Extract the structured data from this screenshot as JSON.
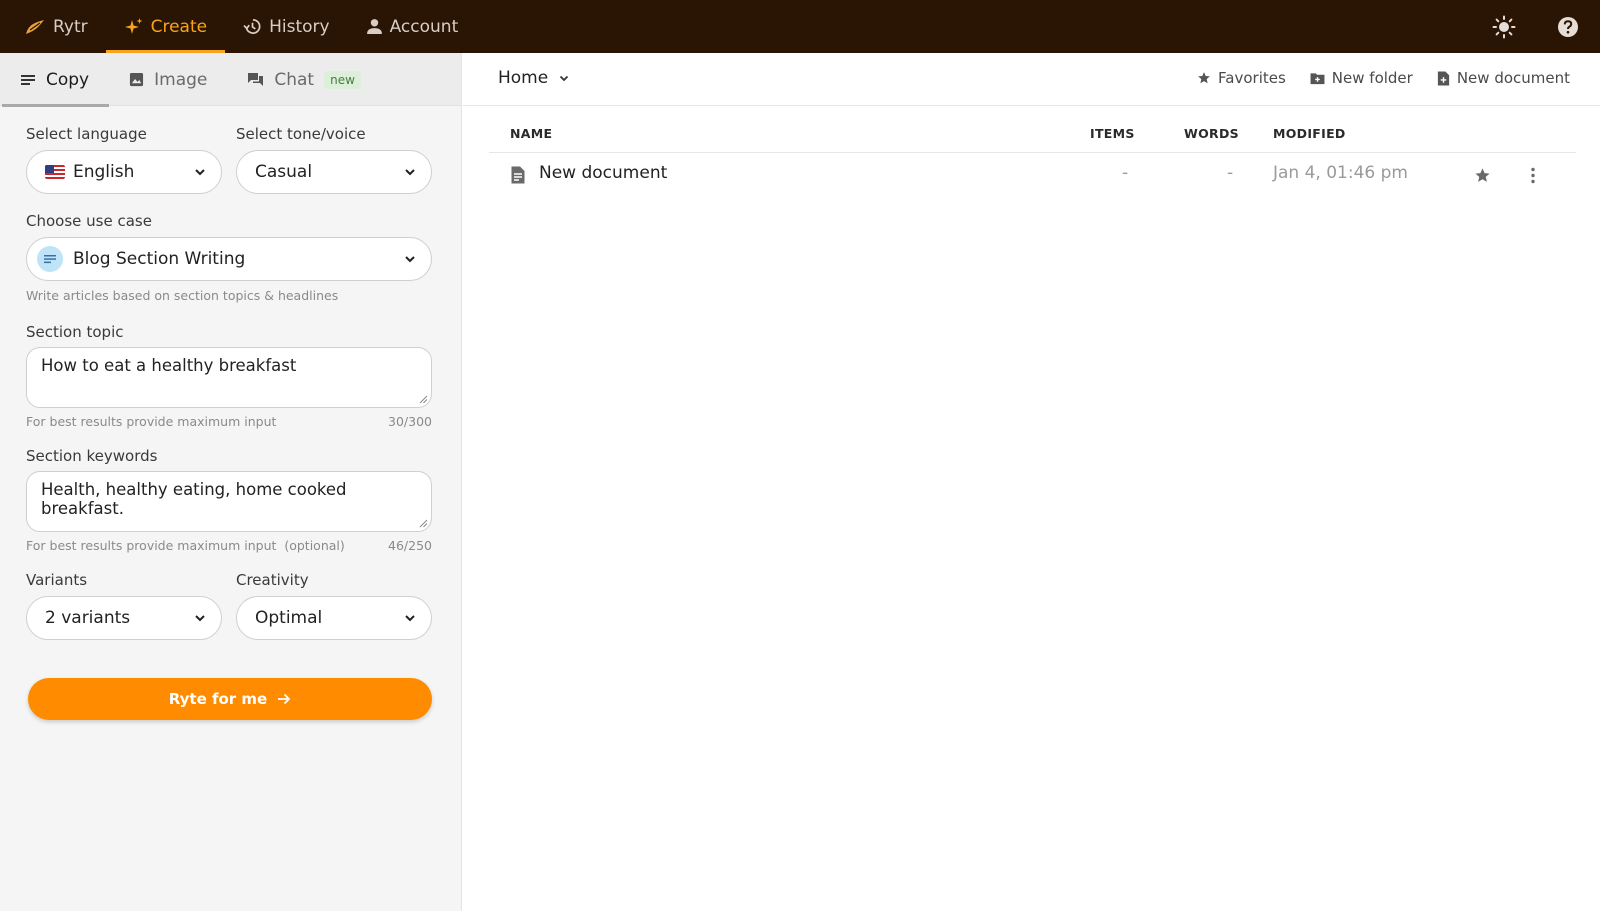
{
  "topnav": {
    "items": [
      {
        "label": "Rytr",
        "icon": "rytr-logo-icon"
      },
      {
        "label": "Create",
        "icon": "sparkle-icon"
      },
      {
        "label": "History",
        "icon": "history-icon"
      },
      {
        "label": "Account",
        "icon": "person-icon"
      }
    ],
    "active": "Create",
    "right_icons": [
      "sun-icon",
      "help-icon"
    ]
  },
  "left": {
    "tabs": [
      {
        "label": "Copy",
        "icon": "lines-icon"
      },
      {
        "label": "Image",
        "icon": "image-icon"
      },
      {
        "label": "Chat",
        "icon": "chat-icon",
        "badge": "new"
      }
    ],
    "active_tab": "Copy",
    "language": {
      "label": "Select language",
      "value": "English"
    },
    "tone": {
      "label": "Select tone/voice",
      "value": "Casual"
    },
    "use_case": {
      "label": "Choose use case",
      "value": "Blog Section Writing",
      "hint": "Write articles based on section topics & headlines"
    },
    "section_topic": {
      "label": "Section topic",
      "value": "How to eat a healthy breakfast",
      "hint": "For best results provide maximum input",
      "count": "30/300"
    },
    "section_keywords": {
      "label": "Section keywords",
      "value": "Health, healthy eating, home cooked breakfast.",
      "hint": "For best results provide maximum input  (optional)",
      "count": "46/250"
    },
    "variants": {
      "label": "Variants",
      "value": "2 variants"
    },
    "creativity": {
      "label": "Creativity",
      "value": "Optimal"
    },
    "cta": "Ryte for me"
  },
  "right": {
    "breadcrumb": "Home",
    "actions": {
      "favorites": "Favorites",
      "new_folder": "New folder",
      "new_document": "New document"
    },
    "columns": {
      "name": "NAME",
      "items": "ITEMS",
      "words": "WORDS",
      "modified": "MODIFIED"
    },
    "rows": [
      {
        "name": "New document",
        "items": "-",
        "words": "-",
        "modified": "Jan 4, 01:46 pm"
      }
    ]
  },
  "colors": {
    "topbar": "#2a1404",
    "accent": "#f8a51b",
    "cta": "#ff8c00"
  }
}
